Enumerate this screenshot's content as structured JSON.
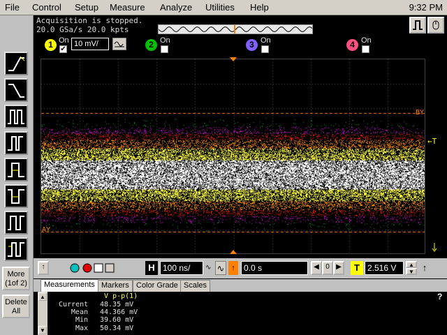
{
  "menubar": {
    "items": [
      "File",
      "Control",
      "Setup",
      "Measure",
      "Analyze",
      "Utilities",
      "Help"
    ],
    "clock": "9:32 PM"
  },
  "status": {
    "acquisition": "Acquisition is stopped.",
    "rate": "20.0 GSa/s   20.0 kpts"
  },
  "channels": [
    {
      "num": "1",
      "on_label": "On",
      "checked": true,
      "color": "#ffff00",
      "scale": "10 mV/"
    },
    {
      "num": "2",
      "on_label": "On",
      "checked": false,
      "color": "#00c000"
    },
    {
      "num": "3",
      "on_label": "On",
      "checked": false,
      "color": "#6040ff"
    },
    {
      "num": "4",
      "on_label": "On",
      "checked": false,
      "color": "#ff4040"
    }
  ],
  "markers": {
    "by": "BY",
    "ay": "AY",
    "trigger": "T"
  },
  "sidebar": {
    "more_label": "More\n(1of 2)",
    "delete_label": "Delete\nAll"
  },
  "controls": {
    "horiz_letter": "H",
    "timebase": "100 ns/",
    "delay": "0.0 s",
    "trigger_letter": "T",
    "trigger_level": "2.516 V"
  },
  "tabs": [
    "Measurements",
    "Markers",
    "Color Grade",
    "Scales"
  ],
  "measurement": {
    "name": "V p-p(1)",
    "rows": [
      {
        "label": "Current",
        "value": "48.35 mV"
      },
      {
        "label": "Mean",
        "value": "44.366 mV"
      },
      {
        "label": "Min",
        "value": "39.60 mV"
      },
      {
        "label": "Max",
        "value": "50.34 mV"
      }
    ]
  },
  "help_glyph": "?",
  "colors": {
    "trace_colorgrade": [
      "#00a020",
      "#ff00ff",
      "#ff2000",
      "#ff9000",
      "#ffff40",
      "#ffffff"
    ],
    "marker": "#ff8000"
  }
}
